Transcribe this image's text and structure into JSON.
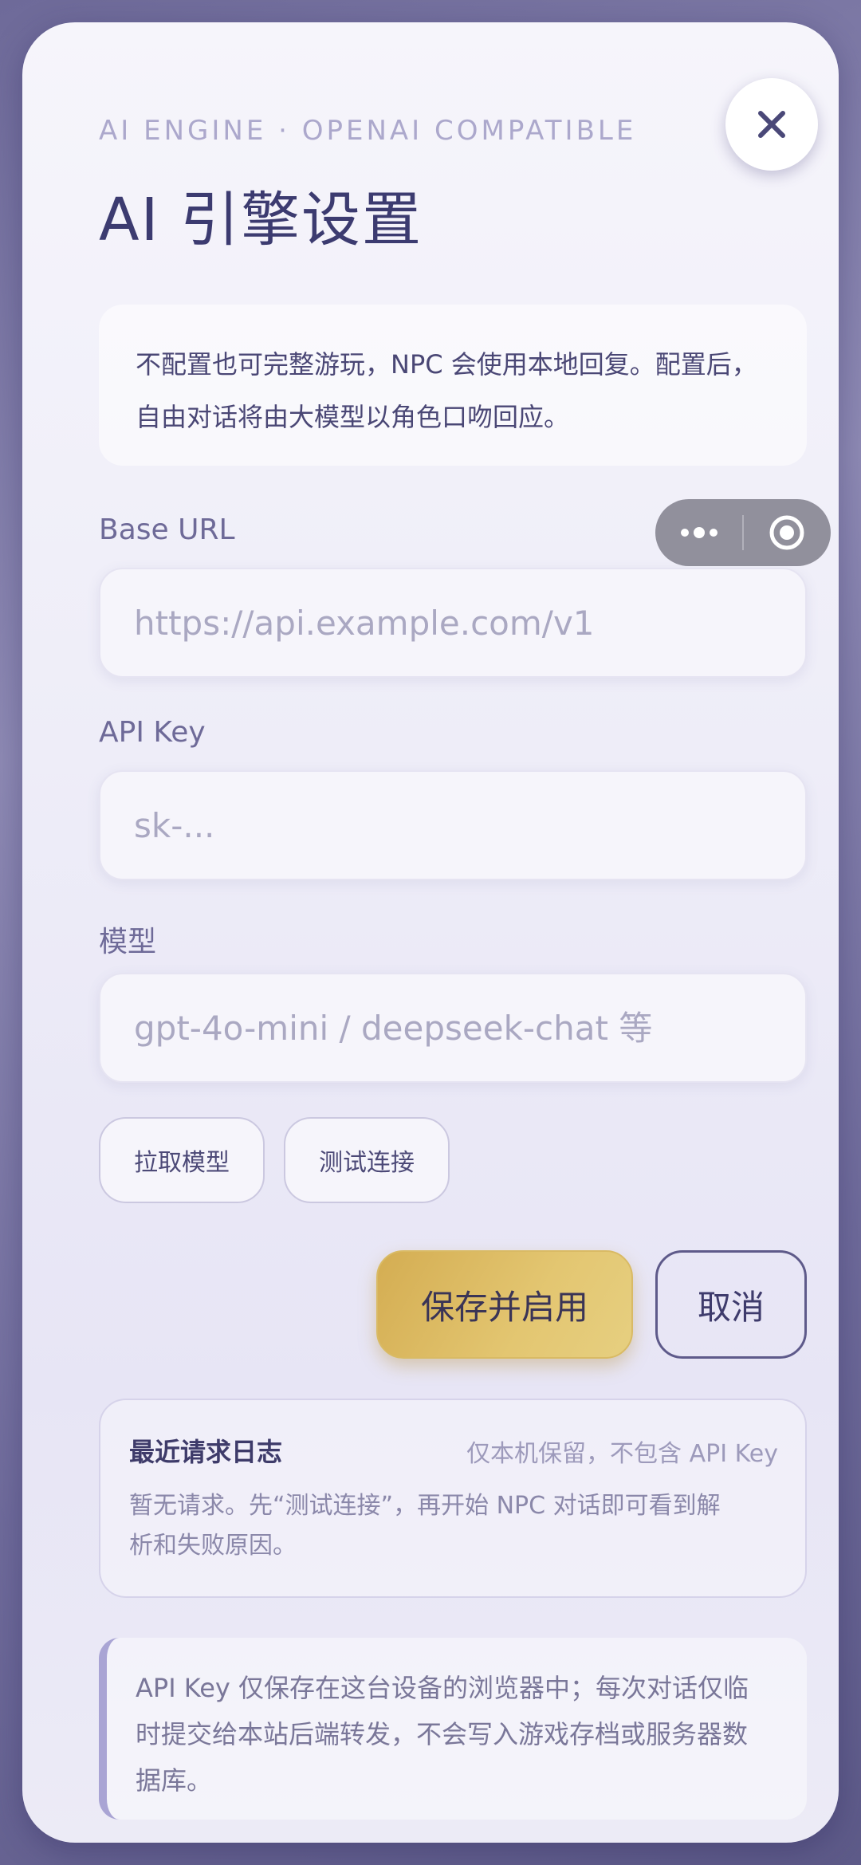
{
  "header": {
    "eyebrow": "AI ENGINE · OPENAI COMPATIBLE",
    "title": "AI 引擎设置"
  },
  "intro": {
    "line1": "不配置也可完整游玩，NPC 会使用本地回复。配置后，",
    "line2": "自由对话将由大模型以角色口吻回应。"
  },
  "fields": {
    "base_url": {
      "label": "Base URL",
      "placeholder": "https://api.example.com/v1",
      "value": ""
    },
    "api_key": {
      "label": "API Key",
      "placeholder": "sk-...",
      "value": ""
    },
    "model": {
      "label": "模型",
      "placeholder": "gpt-4o-mini / deepseek-chat 等",
      "value": ""
    }
  },
  "actions": {
    "fetch_models": "拉取模型",
    "test_connection": "测试连接",
    "save": "保存并启用",
    "cancel": "取消"
  },
  "log": {
    "title": "最近请求日志",
    "note": "仅本机保留，不包含 API Key",
    "line1": "暂无请求。先“测试连接”，再开始 NPC 对话即可看到解",
    "line2": "析和失败原因。"
  },
  "notice": {
    "line1": "API Key 仅保存在这台设备的浏览器中；每次对话仅临",
    "line2": "时提交给本站后端转发，不会写入游戏存档或服务器数",
    "line3": "据库。"
  },
  "icons": {
    "close": "close-icon",
    "more": "more-dots-icon",
    "target": "target-circle-icon"
  },
  "colors": {
    "primary_text": "#3c3b70",
    "accent_gold": "#d4ad52",
    "muted": "#aca8cc"
  }
}
